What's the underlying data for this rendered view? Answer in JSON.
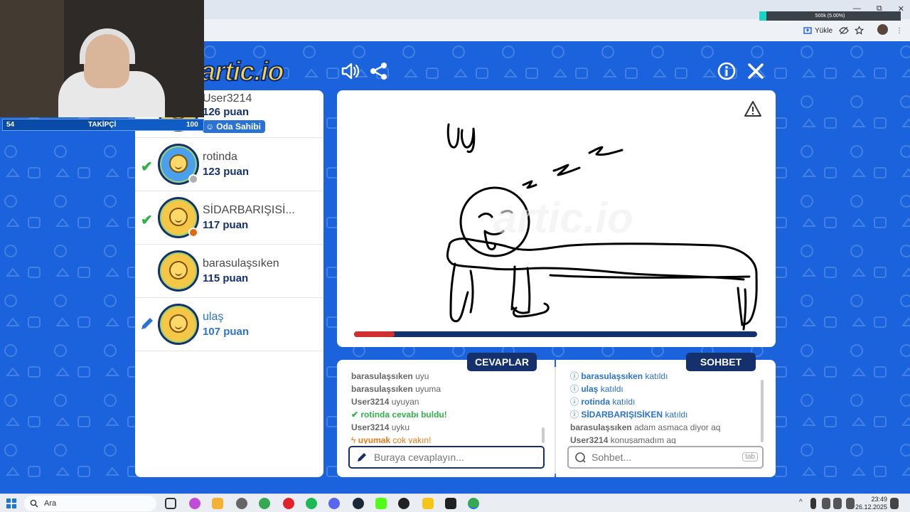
{
  "browser": {
    "upload_label": "Yükle",
    "progress_text": "500k (5.00%)",
    "progress_fraction": 0.05,
    "window_controls": [
      "—",
      "⧉",
      "✕"
    ]
  },
  "webcam": {
    "follow_count": "54",
    "follow_label": "TAKİPÇİ",
    "follow_goal": "100",
    "follow_fraction": 0.54
  },
  "header": {
    "logo_text": "artic.io",
    "sound_icon": "speaker-icon",
    "share_icon": "share-icon",
    "info_icon": "info-icon",
    "close_icon": "close-icon"
  },
  "players": [
    {
      "name": "User3214",
      "score": "126 puan",
      "badge": "Oda Sahibi",
      "status": "none",
      "marker": "none",
      "me": false
    },
    {
      "name": "rotinda",
      "score": "123 puan",
      "badge": "",
      "status": "#b0b0b0",
      "marker": "check",
      "me": false
    },
    {
      "name": "SİDARBARIŞISİ...",
      "score": "117 puan",
      "badge": "",
      "status": "#e06a10",
      "marker": "check",
      "me": false
    },
    {
      "name": "barasulaşsıken",
      "score": "115 puan",
      "badge": "",
      "status": "none",
      "marker": "none",
      "me": false
    },
    {
      "name": "ulaş",
      "score": "107 puan",
      "badge": "",
      "status": "none",
      "marker": "pencil",
      "me": true
    }
  ],
  "canvas": {
    "report_icon": "warning-icon",
    "timer_remaining_fraction": 0.1
  },
  "answers": {
    "tab_label": "CEVAPLAR",
    "messages": [
      {
        "user": "barasulaşsıken",
        "text": "uyu",
        "kind": "plain"
      },
      {
        "user": "barasulaşsıken",
        "text": "uyuma",
        "kind": "plain"
      },
      {
        "user": "User3214",
        "text": "uyuyan",
        "kind": "plain"
      },
      {
        "user": "rotinda",
        "text": "cevabı buldu!",
        "kind": "ok"
      },
      {
        "user": "User3214",
        "text": "uyku",
        "kind": "plain"
      },
      {
        "user": "uyumak",
        "text": "çok yakın!",
        "kind": "close"
      }
    ],
    "input_placeholder": "Buraya cevaplayın..."
  },
  "chat": {
    "tab_label": "SOHBET",
    "messages": [
      {
        "user": "barasulaşsıken",
        "text": "katıldı",
        "kind": "info"
      },
      {
        "user": "ulaş",
        "text": "katıldı",
        "kind": "info"
      },
      {
        "user": "rotinda",
        "text": "katıldı",
        "kind": "info"
      },
      {
        "user": "SİDARBARIŞISİKEN",
        "text": "katıldı",
        "kind": "info"
      },
      {
        "user": "barasulaşsıken",
        "text": "adam asmaca diyor aq",
        "kind": "plain"
      },
      {
        "user": "User3214",
        "text": "konuşamadım aq",
        "kind": "plain"
      }
    ],
    "input_placeholder": "Sohbet...",
    "tab_key": "tab"
  },
  "taskbar": {
    "search_placeholder": "Ara",
    "time": "23:49",
    "date": "26.12.2025"
  }
}
